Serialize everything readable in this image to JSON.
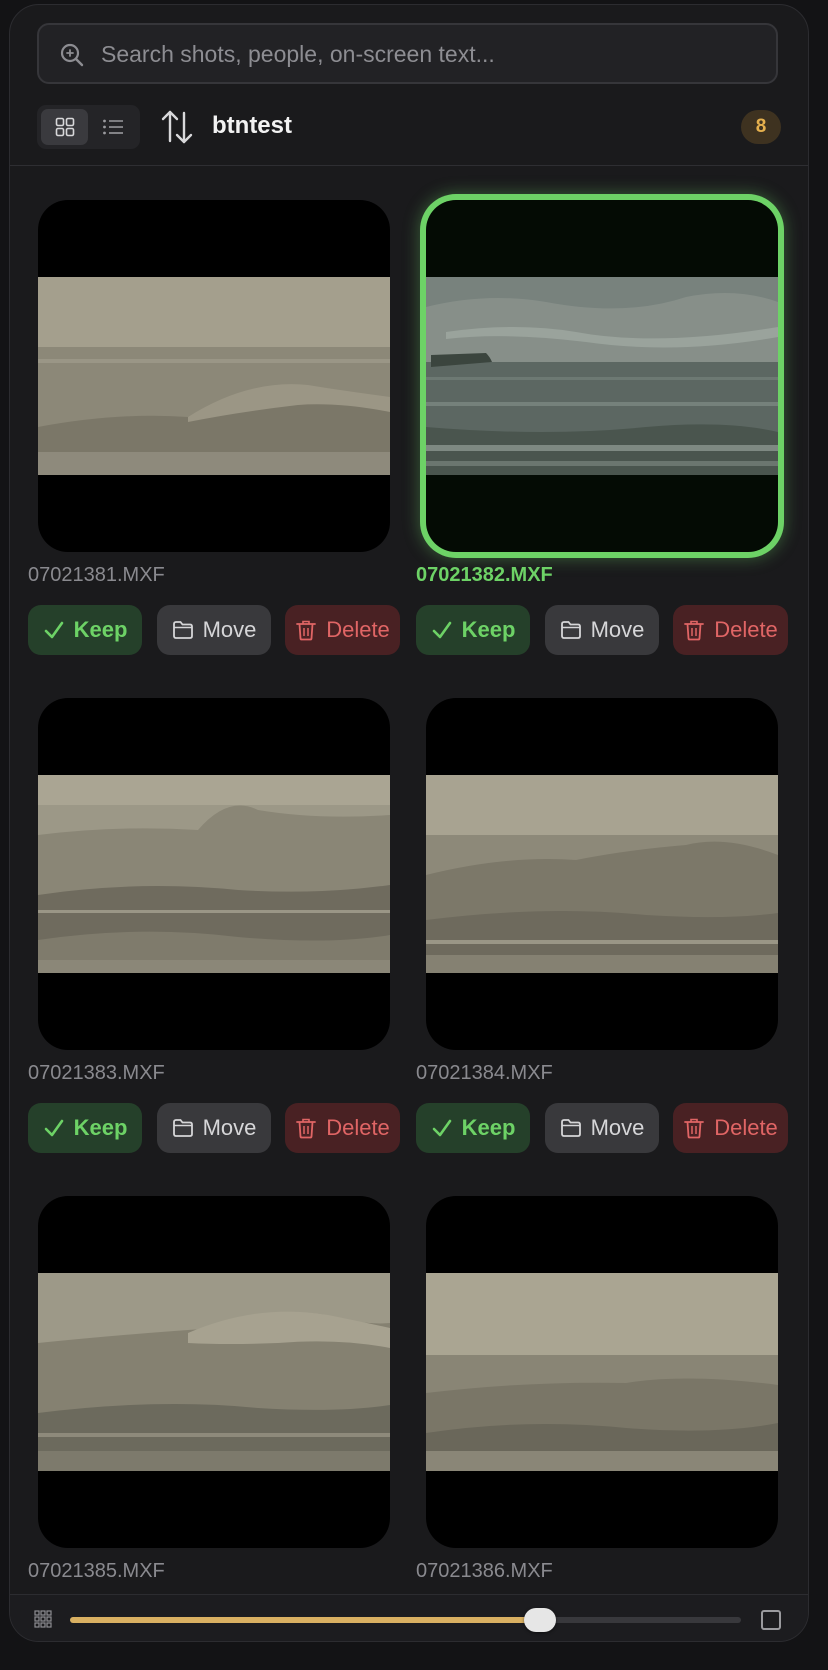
{
  "search": {
    "placeholder": "Search shots, people, on-screen text..."
  },
  "header": {
    "folder_title": "btntest",
    "clip_count": "8"
  },
  "actions": {
    "keep_label": "Keep",
    "move_label": "Move",
    "delete_label": "Delete"
  },
  "clips": [
    {
      "filename": "07021381.MXF",
      "selected": false
    },
    {
      "filename": "07021382.MXF",
      "selected": true
    },
    {
      "filename": "07021383.MXF",
      "selected": false
    },
    {
      "filename": "07021384.MXF",
      "selected": false
    },
    {
      "filename": "07021385.MXF",
      "selected": false
    },
    {
      "filename": "07021386.MXF",
      "selected": false
    }
  ],
  "thumbnail_size_slider": {
    "value_fraction": 0.7
  },
  "colors": {
    "accent_selected": "#6dd266",
    "keep": "#6dd266",
    "delete": "#e06565",
    "badge": "#e5b04e",
    "slider_fill": "#d9b062"
  },
  "icons": [
    "search-icon",
    "grid-view-icon",
    "list-view-icon",
    "sort-icon",
    "checkmark-icon",
    "folder-icon",
    "trash-icon",
    "small-grid-icon",
    "large-square-icon"
  ]
}
